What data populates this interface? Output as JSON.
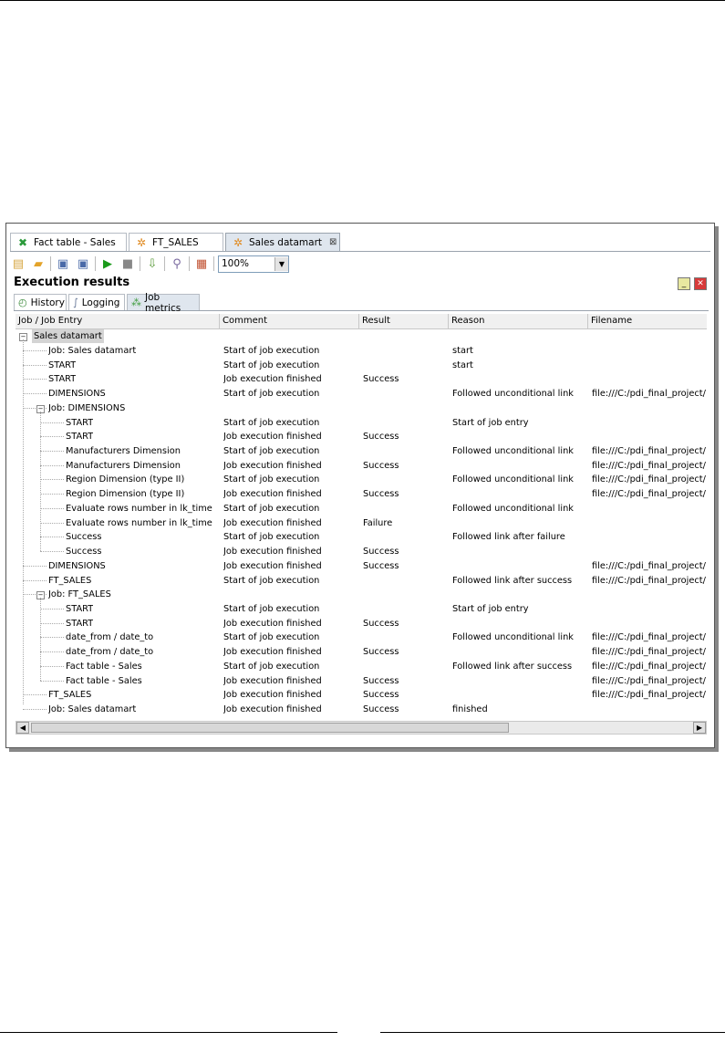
{
  "tabs": [
    {
      "label": "Fact table - Sales",
      "icon": "transformation-icon"
    },
    {
      "label": "FT_SALES",
      "icon": "job-icon"
    },
    {
      "label": "Sales datamart",
      "icon": "job-icon",
      "active": true
    }
  ],
  "toolbar": {
    "zoom": "100%"
  },
  "panel": {
    "title": "Execution results"
  },
  "subtabs": [
    {
      "label": "History",
      "icon": "history-icon"
    },
    {
      "label": "Logging",
      "icon": "logging-icon"
    },
    {
      "label": "Job metrics",
      "icon": "job-metrics-icon",
      "active": true
    }
  ],
  "columns": [
    "Job / Job Entry",
    "Comment",
    "Result",
    "Reason",
    "Filename"
  ],
  "root": "Sales datamart",
  "rows": [
    {
      "entry": "Job: Sales datamart",
      "comment": "Start of job execution",
      "result": "",
      "reason": "start",
      "filename": ""
    },
    {
      "entry": "START",
      "comment": "Start of job execution",
      "result": "",
      "reason": "start",
      "filename": ""
    },
    {
      "entry": "START",
      "comment": "Job execution finished",
      "result": "Success",
      "reason": "",
      "filename": ""
    },
    {
      "entry": "DIMENSIONS",
      "comment": "Start of job execution",
      "result": "",
      "reason": "Followed unconditional link",
      "filename": "file:///C:/pdi_final_project/"
    },
    {
      "entry": "Job: DIMENSIONS",
      "comment": "",
      "result": "",
      "reason": "",
      "filename": ""
    },
    {
      "entry": "START",
      "comment": "Start of job execution",
      "result": "",
      "reason": "Start of job entry",
      "filename": ""
    },
    {
      "entry": "START",
      "comment": "Job execution finished",
      "result": "Success",
      "reason": "",
      "filename": ""
    },
    {
      "entry": "Manufacturers Dimension",
      "comment": "Start of job execution",
      "result": "",
      "reason": "Followed unconditional link",
      "filename": "file:///C:/pdi_final_project/"
    },
    {
      "entry": "Manufacturers Dimension",
      "comment": "Job execution finished",
      "result": "Success",
      "reason": "",
      "filename": "file:///C:/pdi_final_project/"
    },
    {
      "entry": "Region Dimension (type II)",
      "comment": "Start of job execution",
      "result": "",
      "reason": "Followed unconditional link",
      "filename": "file:///C:/pdi_final_project/"
    },
    {
      "entry": "Region Dimension (type II)",
      "comment": "Job execution finished",
      "result": "Success",
      "reason": "",
      "filename": "file:///C:/pdi_final_project/"
    },
    {
      "entry": "Evaluate rows number in lk_time",
      "comment": "Start of job execution",
      "result": "",
      "reason": "Followed unconditional link",
      "filename": ""
    },
    {
      "entry": "Evaluate rows number in lk_time",
      "comment": "Job execution finished",
      "result": "Failure",
      "reason": "",
      "filename": ""
    },
    {
      "entry": "Success",
      "comment": "Start of job execution",
      "result": "",
      "reason": "Followed link after failure",
      "filename": ""
    },
    {
      "entry": "Success",
      "comment": "Job execution finished",
      "result": "Success",
      "reason": "",
      "filename": ""
    },
    {
      "entry": "DIMENSIONS",
      "comment": "Job execution finished",
      "result": "Success",
      "reason": "",
      "filename": "file:///C:/pdi_final_project/"
    },
    {
      "entry": "FT_SALES",
      "comment": "Start of job execution",
      "result": "",
      "reason": "Followed link after success",
      "filename": "file:///C:/pdi_final_project/"
    },
    {
      "entry": "Job: FT_SALES",
      "comment": "",
      "result": "",
      "reason": "",
      "filename": ""
    },
    {
      "entry": "START",
      "comment": "Start of job execution",
      "result": "",
      "reason": "Start of job entry",
      "filename": ""
    },
    {
      "entry": "START",
      "comment": "Job execution finished",
      "result": "Success",
      "reason": "",
      "filename": ""
    },
    {
      "entry": "date_from / date_to",
      "comment": "Start of job execution",
      "result": "",
      "reason": "Followed unconditional link",
      "filename": "file:///C:/pdi_final_project/"
    },
    {
      "entry": "date_from / date_to",
      "comment": "Job execution finished",
      "result": "Success",
      "reason": "",
      "filename": "file:///C:/pdi_final_project/"
    },
    {
      "entry": "Fact table - Sales",
      "comment": "Start of job execution",
      "result": "",
      "reason": "Followed link after success",
      "filename": "file:///C:/pdi_final_project/"
    },
    {
      "entry": "Fact table - Sales",
      "comment": "Job execution finished",
      "result": "Success",
      "reason": "",
      "filename": "file:///C:/pdi_final_project/"
    },
    {
      "entry": "FT_SALES",
      "comment": "Job execution finished",
      "result": "Success",
      "reason": "",
      "filename": "file:///C:/pdi_final_project/"
    },
    {
      "entry": "Job: Sales datamart",
      "comment": "Job execution finished",
      "result": "Success",
      "reason": "finished",
      "filename": ""
    }
  ]
}
